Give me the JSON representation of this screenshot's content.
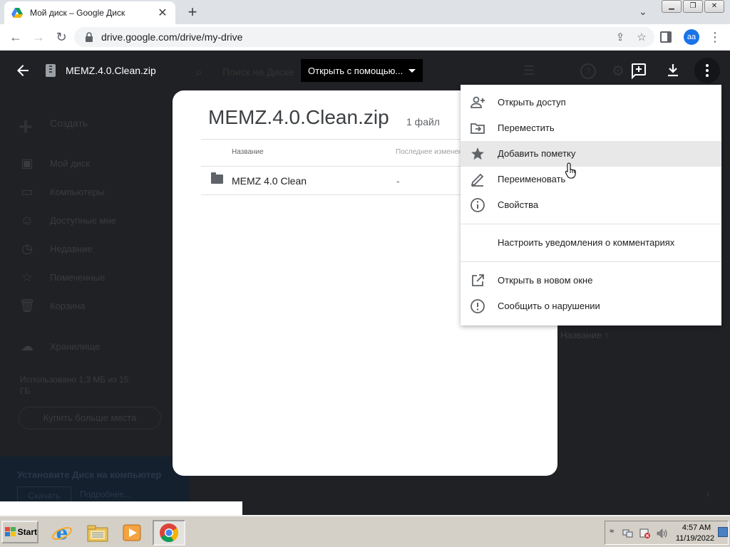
{
  "browser": {
    "tab_title": "Мой диск – Google Диск",
    "url": "drive.google.com/drive/my-drive",
    "profile_initials": "aa"
  },
  "drive_background": {
    "create_label": "Создать",
    "sidebar_items": [
      {
        "label": "Мой диск",
        "icon": "my-drive-icon"
      },
      {
        "label": "Компьютеры",
        "icon": "computers-icon"
      },
      {
        "label": "Доступные мне",
        "icon": "shared-icon"
      },
      {
        "label": "Недавние",
        "icon": "clock-icon"
      },
      {
        "label": "Помеченные",
        "icon": "star-icon"
      },
      {
        "label": "Корзина",
        "icon": "trash-icon"
      }
    ],
    "storage_label": "Хранилище",
    "storage_used": "Использовано 1,3 МБ из 15 ГБ",
    "buy_storage": "Купить больше места",
    "install_title": "Установите Диск на компьютер",
    "install_download": "Скачать",
    "install_more": "Подробнее...",
    "search_placeholder": "Поиск на Диске",
    "sort_label": "Название"
  },
  "preview": {
    "filename": "MEMZ.4.0.Clean.zip",
    "open_with": "Открыть с помощью..."
  },
  "zip_card": {
    "title": "MEMZ.4.0.Clean.zip",
    "file_count": "1 файл",
    "col_name": "Название",
    "col_modified": "Последнее изменение",
    "rows": [
      {
        "name": "MEMZ 4.0 Clean",
        "modified": "-"
      }
    ]
  },
  "context_menu": {
    "share": "Открыть доступ",
    "move": "Переместить",
    "star": "Добавить пометку",
    "rename": "Переименовать",
    "details": "Свойства",
    "comment_notifications": "Настроить уведомления о комментариях",
    "open_new_window": "Открыть в новом окне",
    "report_abuse": "Сообщить о нарушении"
  },
  "taskbar": {
    "start_label": "Start",
    "time": "4:57 AM",
    "date": "11/19/2022"
  },
  "colors": {
    "drive_dark": "#202124",
    "menu_hover": "#e8e8e8",
    "profile_blue": "#1a73e8",
    "taskbar_gray": "#d4d0c8"
  }
}
